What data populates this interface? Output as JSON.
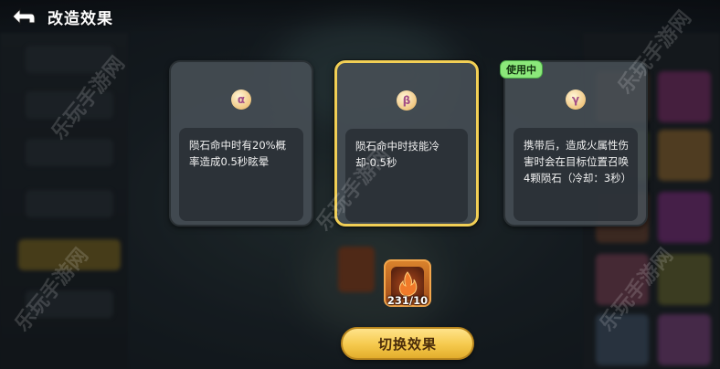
{
  "header": {
    "title": "改造效果",
    "back_icon": "back-arrow-icon"
  },
  "cards": [
    {
      "symbol": "α",
      "description": "陨石命中时有20%概率造成0.5秒眩晕",
      "selected": false,
      "in_use": false
    },
    {
      "symbol": "β",
      "description": "陨石命中时技能冷却-0.5秒",
      "selected": true,
      "in_use": false
    },
    {
      "symbol": "γ",
      "description": "携带后，造成火属性伤害时会在目标位置召唤4颗陨石（冷却：3秒）",
      "selected": false,
      "in_use": true
    }
  ],
  "in_use_label": "使用中",
  "material": {
    "icon": "fire-crystal-icon",
    "count": "231/10"
  },
  "switch_button": {
    "label": "切换效果"
  },
  "watermark": "乐玩手游网",
  "colors": {
    "selected_border": "#f2cf55",
    "in_use_tag": "#8be87a",
    "button_fill": "#f5c94c"
  }
}
